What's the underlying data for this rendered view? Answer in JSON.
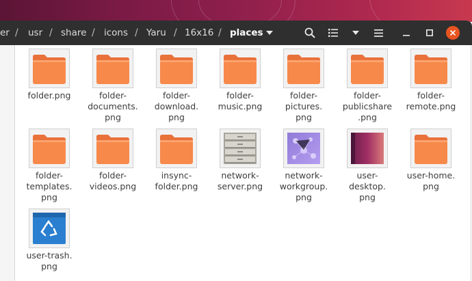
{
  "breadcrumb": {
    "items": [
      "er",
      "usr",
      "share",
      "icons",
      "Yaru",
      "16x16"
    ],
    "current": "places"
  },
  "toolbar": {
    "search_icon": "search-icon",
    "view_icon": "list-view-icon",
    "sort_icon": "chevron-down-icon",
    "menu_icon": "hamburger-icon"
  },
  "window_controls": [
    "minimize",
    "maximize",
    "close"
  ],
  "files": [
    {
      "name": "folder.png",
      "icon": "folder"
    },
    {
      "name": "folder-\ndocuments.\npng",
      "icon": "folder"
    },
    {
      "name": "folder-\ndownload.\npng",
      "icon": "folder"
    },
    {
      "name": "folder-\nmusic.png",
      "icon": "folder"
    },
    {
      "name": "folder-\npictures.\npng",
      "icon": "folder"
    },
    {
      "name": "folder-\npublicshare\n.png",
      "icon": "folder"
    },
    {
      "name": "folder-\nremote.png",
      "icon": "folder"
    },
    {
      "name": "folder-\ntemplates.\npng",
      "icon": "folder"
    },
    {
      "name": "folder-\nvideos.png",
      "icon": "folder"
    },
    {
      "name": "insync-\nfolder.png",
      "icon": "folder"
    },
    {
      "name": "network-\nserver.png",
      "icon": "server"
    },
    {
      "name": "network-\nworkgroup.\npng",
      "icon": "workgroup"
    },
    {
      "name": "user-\ndesktop.\npng",
      "icon": "desktop"
    },
    {
      "name": "user-home.\npng",
      "icon": "folder"
    },
    {
      "name": "user-trash.\npng",
      "icon": "trash"
    }
  ],
  "colors": {
    "folder_orange": "#f7894a",
    "headerbar": "#2f2f2f",
    "close_button": "#e95420"
  }
}
